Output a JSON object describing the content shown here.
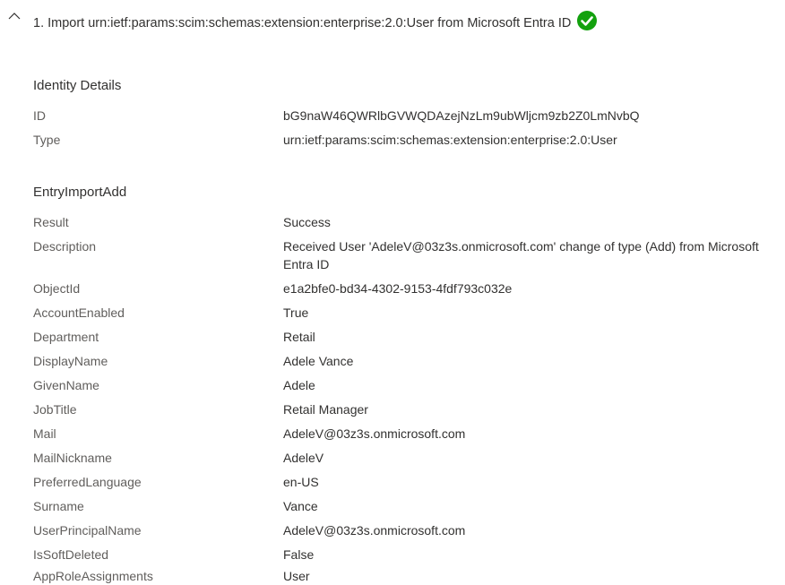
{
  "step": {
    "title": "1. Import urn:ietf:params:scim:schemas:extension:enterprise:2.0:User from Microsoft Entra ID",
    "status": "success",
    "status_color": "#13a10e",
    "chevron_icon": "chevron-up-icon"
  },
  "identity_details": {
    "title": "Identity Details",
    "rows": [
      {
        "key": "ID",
        "value": "bG9naW46QWRlbGVWQDAzejNzLm9ubWljcm9zb2Z0LmNvbQ"
      },
      {
        "key": "Type",
        "value": "urn:ietf:params:scim:schemas:extension:enterprise:2.0:User"
      }
    ]
  },
  "entry_import_add": {
    "title": "EntryImportAdd",
    "rows": [
      {
        "key": "Result",
        "value": "Success"
      },
      {
        "key": "Description",
        "value": "Received User 'AdeleV@03z3s.onmicrosoft.com' change of type (Add) from Microsoft Entra ID"
      },
      {
        "key": "ObjectId",
        "value": "e1a2bfe0-bd34-4302-9153-4fdf793c032e"
      },
      {
        "key": "AccountEnabled",
        "value": "True"
      },
      {
        "key": "Department",
        "value": "Retail"
      },
      {
        "key": "DisplayName",
        "value": "Adele Vance"
      },
      {
        "key": "GivenName",
        "value": "Adele"
      },
      {
        "key": "JobTitle",
        "value": "Retail Manager"
      },
      {
        "key": "Mail",
        "value": "AdeleV@03z3s.onmicrosoft.com"
      },
      {
        "key": "MailNickname",
        "value": "AdeleV"
      },
      {
        "key": "PreferredLanguage",
        "value": "en-US"
      },
      {
        "key": "Surname",
        "value": "Vance"
      },
      {
        "key": "UserPrincipalName",
        "value": "AdeleV@03z3s.onmicrosoft.com"
      },
      {
        "key": "IsSoftDeleted",
        "value": "False"
      },
      {
        "key": "AppRoleAssignments",
        "value": "User"
      }
    ]
  }
}
